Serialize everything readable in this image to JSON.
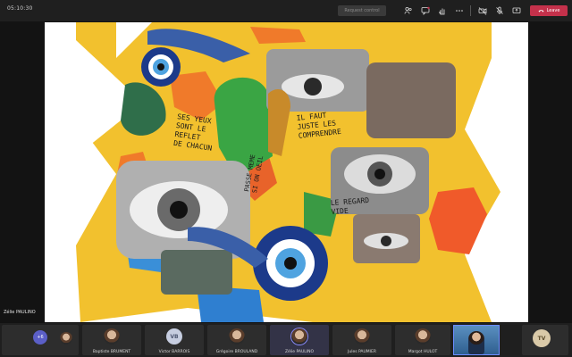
{
  "topbar": {
    "timer": "05:10:30",
    "request_control": "Request control",
    "leave_label": "Leave"
  },
  "stage": {
    "presenter": "Zélie PAULINO"
  },
  "strip": {
    "more_count": "+6",
    "participants": [
      {
        "name": "Baptiste BRUMENT",
        "avatar": "photo"
      },
      {
        "name": "Victor BARROIS",
        "avatar": "initials",
        "initials": "VB"
      },
      {
        "name": "Grégoire BROULAND",
        "avatar": "photo"
      },
      {
        "name": "Zélie PAULINO",
        "avatar": "photo"
      },
      {
        "name": "Jules PAUMIER",
        "avatar": "photo"
      },
      {
        "name": "Margot HULOT",
        "avatar": "photo"
      }
    ],
    "tv_initials": "TV"
  },
  "collage": {
    "text_left": "SES YEUX\nSONT LE\nREFLET\nDE CHACUN",
    "text_center": "IL FAUT\nJUSTE LES\nCOMPRENDRE",
    "text_right": "LE REGARD\nVIDE",
    "text_bottom": "PASSE MEME\nSI ON OEIL"
  },
  "colors": {
    "leave": "#c4314b",
    "accent": "#5b5fc7",
    "collage_yellow": "#f2c12e"
  }
}
